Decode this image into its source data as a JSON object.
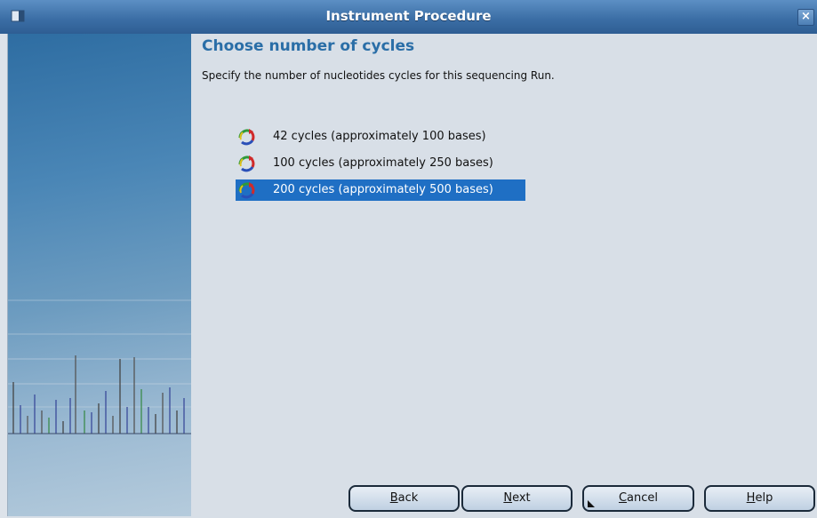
{
  "window": {
    "title": "Instrument Procedure",
    "close_label": "×"
  },
  "main": {
    "heading": "Choose number of cycles",
    "description": "Specify the number of nucleotides cycles for this sequencing Run.",
    "options": [
      {
        "label": "42 cycles (approximately 100 bases)",
        "selected": false,
        "icon": "cycle-arrows-icon"
      },
      {
        "label": "100 cycles (approximately 250 bases)",
        "selected": false,
        "icon": "cycle-arrows-icon"
      },
      {
        "label": "200 cycles (approximately 500 bases)",
        "selected": true,
        "icon": "cycle-arrows-icon"
      }
    ]
  },
  "buttons": {
    "back": {
      "first": "B",
      "rest": "ack"
    },
    "next": {
      "first": "N",
      "rest": "ext"
    },
    "cancel": {
      "first": "C",
      "rest": "ancel"
    },
    "help": {
      "first": "H",
      "rest": "elp"
    }
  },
  "colors": {
    "accent": "#2a6ea7",
    "selection": "#1f6fc4",
    "titlebar": "#3c6fa6"
  }
}
